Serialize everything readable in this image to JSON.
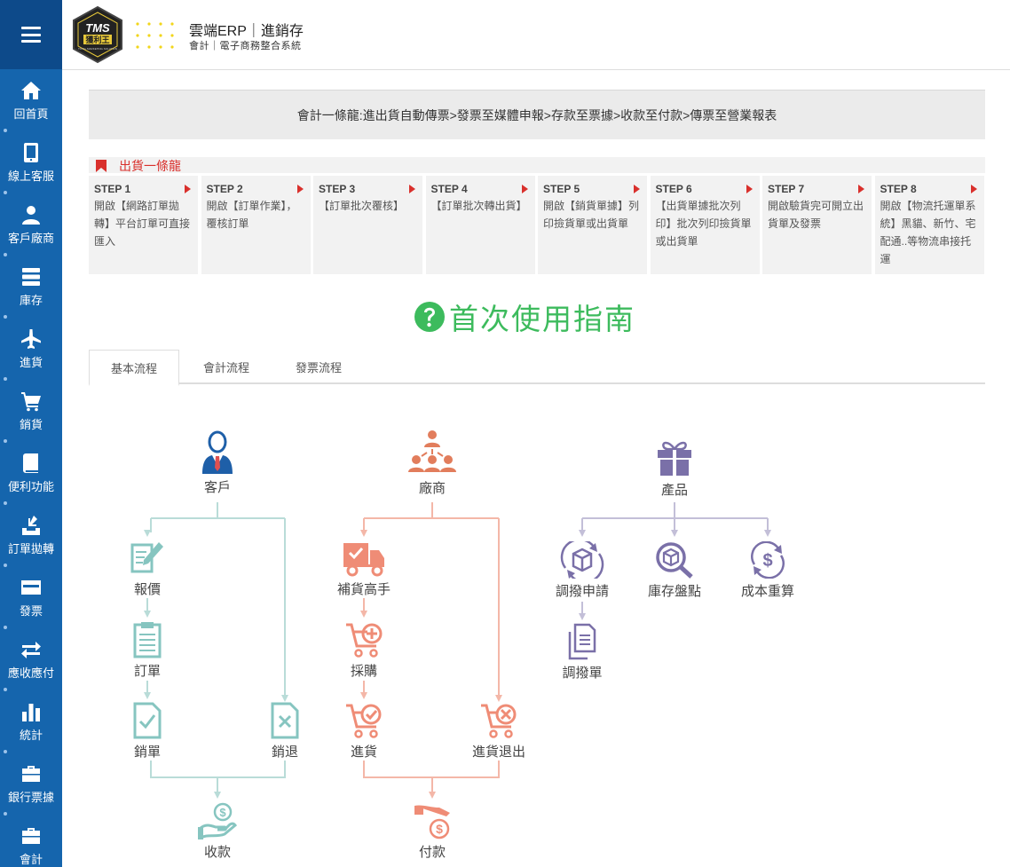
{
  "sidebar": {
    "items": [
      {
        "label": "回首頁",
        "icon": "home-icon"
      },
      {
        "label": "線上客服",
        "icon": "mobile-icon"
      },
      {
        "label": "客戶廠商",
        "icon": "user-icon"
      },
      {
        "label": "庫存",
        "icon": "server-icon"
      },
      {
        "label": "進貨",
        "icon": "airplane-icon"
      },
      {
        "label": "銷貨",
        "icon": "cart-icon"
      },
      {
        "label": "便利功能",
        "icon": "book-icon"
      },
      {
        "label": "訂單拋轉",
        "icon": "download-icon"
      },
      {
        "label": "發票",
        "icon": "card-icon"
      },
      {
        "label": "應收應付",
        "icon": "exchange-icon"
      },
      {
        "label": "統計",
        "icon": "bar-chart-icon"
      },
      {
        "label": "銀行票據",
        "icon": "briefcase-icon"
      },
      {
        "label": "會計",
        "icon": "briefcase-icon"
      }
    ]
  },
  "header": {
    "logo_text": "TMS",
    "logo_sub": "獲利王",
    "logo_tiny": "TOTAL MARKETING SOLUTION",
    "title": "雲端ERP｜進銷存",
    "subtitle": "會計｜電子商務整合系統"
  },
  "banner": "會計一條龍:進出貨自動傳票>發票至媒體申報>存款至票據>收款至付款>傳票至營業報表",
  "flow": {
    "title": "出貨一條龍",
    "steps": [
      {
        "head": "STEP 1",
        "text": "開啟【網路訂單拋轉】平台訂單可直接匯入"
      },
      {
        "head": "STEP 2",
        "text": "開啟【訂單作業】，覆核訂單"
      },
      {
        "head": "STEP 3",
        "text": "【訂單批次覆核】"
      },
      {
        "head": "STEP 4",
        "text": "【訂單批次轉出貨】"
      },
      {
        "head": "STEP 5",
        "text": "開啟【銷貨單據】列印撿貨單或出貨單"
      },
      {
        "head": "STEP 6",
        "text": "【出貨單據批次列印】批次列印撿貨單或出貨單"
      },
      {
        "head": "STEP 7",
        "text": "開啟驗貨完可開立出貨單及發票"
      },
      {
        "head": "STEP 8",
        "text": "開啟【物流托運單系統】黑貓、新竹、宅配通..等物流串接托運"
      }
    ]
  },
  "guide": {
    "title": "首次使用指南"
  },
  "tabs": [
    {
      "label": "基本流程",
      "active": true
    },
    {
      "label": "會計流程",
      "active": false
    },
    {
      "label": "發票流程",
      "active": false
    }
  ],
  "diagram": {
    "colors": {
      "customer": "#86c5c0",
      "vendor": "#ef8c76",
      "product": "#7a70a8",
      "vendor_line": "#f4b7a8",
      "customer_line": "#b9dcd8",
      "product_line": "#c3bfd8"
    },
    "nodes": {
      "customer": "客戶",
      "quote": "報價",
      "order": "訂單",
      "sale": "銷單",
      "sale_return": "銷退",
      "receive": "收款",
      "vendor": "廠商",
      "replenish": "補貨高手",
      "purchase": "採購",
      "stock_in": "進貨",
      "stock_return": "進貨退出",
      "pay": "付款",
      "product": "產品",
      "transfer_request": "調撥申請",
      "inventory_check": "庫存盤點",
      "cost_recalc": "成本重算",
      "transfer_doc": "調撥單"
    }
  }
}
